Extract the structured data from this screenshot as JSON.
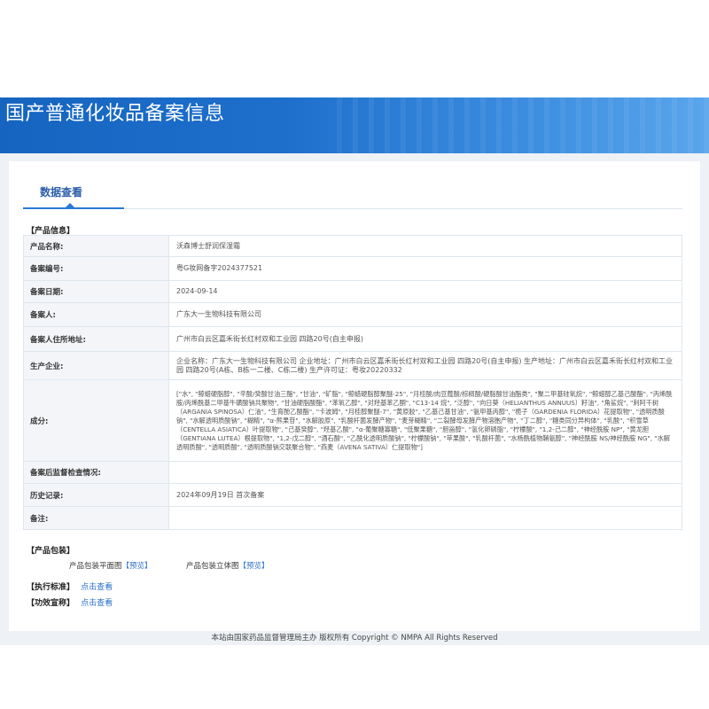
{
  "header": {
    "title": "国产普通化妆品备案信息"
  },
  "tab": {
    "label": "数据查看"
  },
  "product_info": {
    "section_title": "【产品信息】",
    "rows": [
      {
        "key": "产品名称:",
        "value": "沃森博士舒润保湿霜"
      },
      {
        "key": "备案编号:",
        "value": "粤G妆网备字2024377521"
      },
      {
        "key": "备案日期:",
        "value": "2024-09-14"
      },
      {
        "key": "备案人:",
        "value": "广东大一生物科技有限公司"
      },
      {
        "key": "备案人住所地址:",
        "value": "广州市白云区嘉禾街长红村双和工业园 四路20号(自主申报)"
      },
      {
        "key": "生产企业:",
        "value": "企业名称：广东大一生物科技有限公司  企业地址：广州市白云区嘉禾街长红村双和工业园 四路20号(自主申报)  生产地址：广州市白云区嘉禾街长红村双和工业园 四路20号(A栋、B栋一二楼、C栋二楼)  生产许可证：粤妆20220332"
      },
      {
        "key": "成分:",
        "value": "[\"水\", \"鲸蜡硬脂醇\", \"辛酸/癸酸甘油三酯\", \"甘油\", \"矿脂\", \"鲸蜡硬脂醇聚醚-25\", \"月桂酸/肉豆蔻酸/棕榈酸/硬脂酸甘油酯类\", \"聚二甲基硅氧烷\", \"鲸蜡醇乙基己酸酯\", \"丙烯酰胺/丙烯酰基二甲基牛磺酸钠共聚物\", \"甘油硬脂酸酯\", \"苯氧乙醇\", \"对羟基苯乙酮\", \"C13-14 烷\", \"泛醇\", \"向日葵（HELIANTHUS ANNUUS）籽油\", \"角鲨烷\", \"刺阿干树（ARGANIA SPINOSA）仁油\", \"生育酚乙酸酯\", \"卡波姆\", \"月桂醇聚醚-7\", \"黄原胶\", \"乙基己基甘油\", \"氨甲基丙醇\", \"栀子（GARDENIA FLORIDA）花提取物\", \"透明质酸钠\", \"水解透明质酸钠\", \"糊精\", \"α-熊果苷\", \"水解胶原\", \"乳酸杆菌发酵产物\", \"麦芽糊精\", \"二裂酵母发酵产物溶胞产物\", \"丁二醇\", \"糖类同分异构体\", \"乳酸\", \"积雪草（CENTELLA ASIATICA）叶提取物\", \"己基癸醇\", \"羟基乙酸\", \"α-葡聚糖寡糖\", \"低聚果糖\", \"胆甾醇\", \"氢化卵磷脂\", \"柠檬酸\", \"1,2-己二醇\", \"神经酰胺 NP\", \"黄龙胆（GENTIANA LUTEA）根提取物\", \"1,2-戊二醇\", \"酒石酸\", \"乙酰化透明质酸钠\", \"柠檬酸钠\", \"苹果酸\", \"乳酸杆菌\", \"水杨酰植物鞘氨醇\", \"神经酰胺 NS/神经酰胺 NG\", \"水解透明质酸\", \"透明质酸\", \"透明质酸钠交联聚合物\", \"燕麦（AVENA SATIVA）仁提取物\"]"
      },
      {
        "key": "备案后监督检查情况:",
        "value": ""
      },
      {
        "key": "历史记录:",
        "value": "2024年09月19日 首次备案"
      },
      {
        "key": "备注:",
        "value": ""
      }
    ]
  },
  "packaging": {
    "section_title": "【产品包装】",
    "flat_label": "产品包装平面图",
    "solid_label": "产品包装立体图",
    "preview_open": "【",
    "preview_text": "预览",
    "preview_close": "】"
  },
  "standards": {
    "label": "【执行标准】",
    "link": "点击查看"
  },
  "claims": {
    "label": "【功效宣称】",
    "link": "点击查看"
  },
  "footer": {
    "text": "本站由国家药品监督管理局主办 版权所有 Copyright © NMPA All Rights Reserved"
  }
}
